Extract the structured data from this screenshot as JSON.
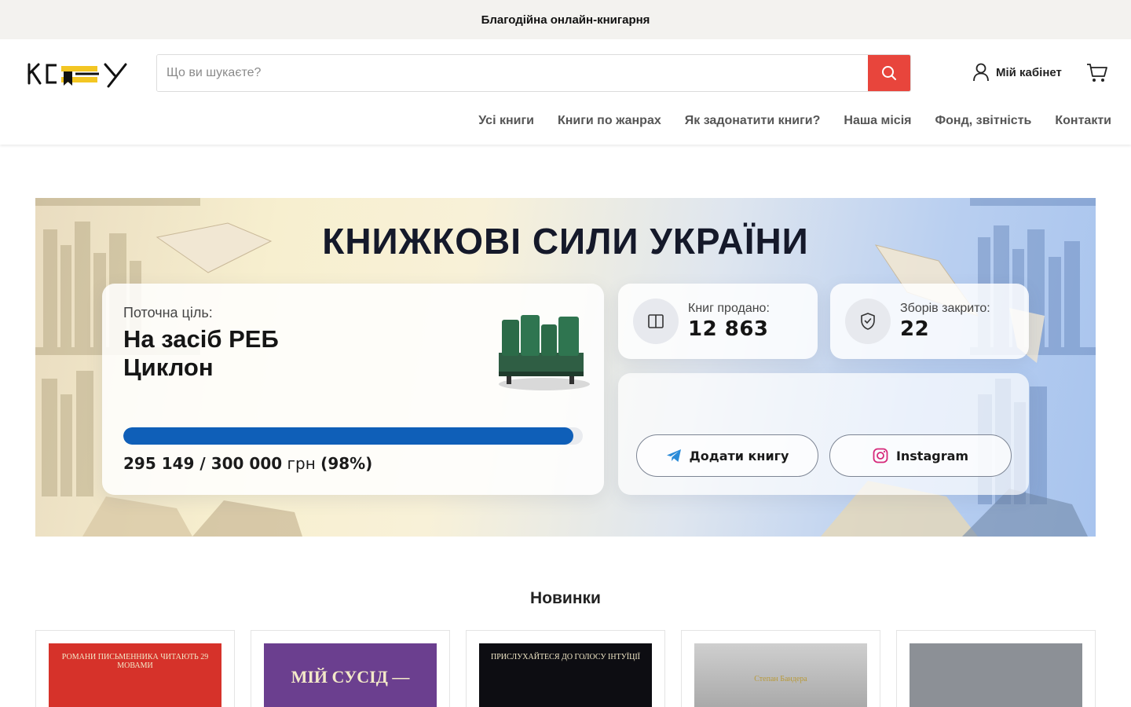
{
  "announcement": "Благодійна онлайн-книгарня",
  "header": {
    "logo_text": "КСУ",
    "search": {
      "placeholder": "Що ви шукаєте?",
      "value": ""
    },
    "account_label": "Мій кабінет",
    "nav": [
      "Усі книги",
      "Книги по жанрах",
      "Як задонатити книги?",
      "Наша місія",
      "Фонд, звітність",
      "Контакти"
    ]
  },
  "hero": {
    "title": "КНИЖКОВІ СИЛИ УКРАЇНИ",
    "goal": {
      "label": "Поточна ціль:",
      "name": "На засіб РЕБ Циклон",
      "raised": "295 149",
      "target": "300 000",
      "currency": "грн",
      "percent_text": "(98%)",
      "progress_fraction": 0.98
    },
    "stats": [
      {
        "label": "Книг продано:",
        "value": "12 863",
        "icon": "book-icon"
      },
      {
        "label": "Зборів закрито:",
        "value": "22",
        "icon": "shield-check-icon"
      }
    ],
    "actions": [
      {
        "label": "Додати книгу",
        "icon": "telegram-icon"
      },
      {
        "label": "Instagram",
        "icon": "instagram-icon"
      }
    ]
  },
  "new_arrivals": {
    "title": "Новинки",
    "products": [
      {
        "cover_bg": "#d6322a",
        "cover_text": "РОМАНИ ПИСЬМЕННИКА ЧИТАЮТЬ 29 МОВАМИ"
      },
      {
        "cover_bg": "#6b3f8f",
        "cover_text": "МІЙ СУСІД —"
      },
      {
        "cover_bg": "#0d0d12",
        "cover_text": "ПРИСЛУХАЙТЕСЯ ДО ГОЛОСУ ІНТУЇЦІЇ"
      },
      {
        "cover_bg": "#c9c9c9",
        "cover_text": "Степан Бандера"
      },
      {
        "cover_bg": "#8c9096",
        "cover_text": ""
      }
    ]
  },
  "colors": {
    "accent_red": "#e8453c",
    "progress_blue": "#0f5fb8",
    "logo_yellow": "#f3c623"
  }
}
